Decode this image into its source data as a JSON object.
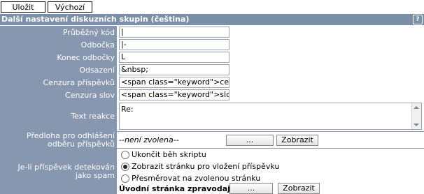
{
  "toolbar": {
    "save_label": "Uložit",
    "default_label": "Výchozí"
  },
  "header": {
    "title": "Další nastavení diskuzních skupin (čeština)",
    "help": "?"
  },
  "fields": {
    "running_code": {
      "label": "Průběžný kód",
      "value": "|"
    },
    "branch": {
      "label": "Odbočka",
      "value": "|-"
    },
    "branch_end": {
      "label": "Konec odbočky",
      "value": "L"
    },
    "indent": {
      "label": "Odsazení",
      "value": "&nbsp;"
    },
    "post_censor": {
      "label": "Cenzura příspěvků",
      "value": "<span class=\"keyword\">cenzurov"
    },
    "word_censor": {
      "label": "Cenzura slov",
      "value": "<span class=\"keyword\">slovo cen"
    },
    "reply_text": {
      "label": "Text reakce",
      "value": "Re:"
    },
    "unsubscribe_template": {
      "label": "Předloha pro odhlášení odběru příspěvků",
      "value": "--není zvolena--",
      "browse": "...",
      "show": "Zobrazit"
    },
    "spam": {
      "label": "Je-li příspěvek detekován jako spam",
      "options": [
        "Ukončit běh skriptu",
        "Zobrazit stránku pro vložení příspěvku",
        "Přesměrovat na zvolenou stránku"
      ],
      "selected": 1,
      "landing_label": "Úvodní stránka zpravodajství",
      "browse": "...",
      "show": "Zobrazit"
    }
  }
}
